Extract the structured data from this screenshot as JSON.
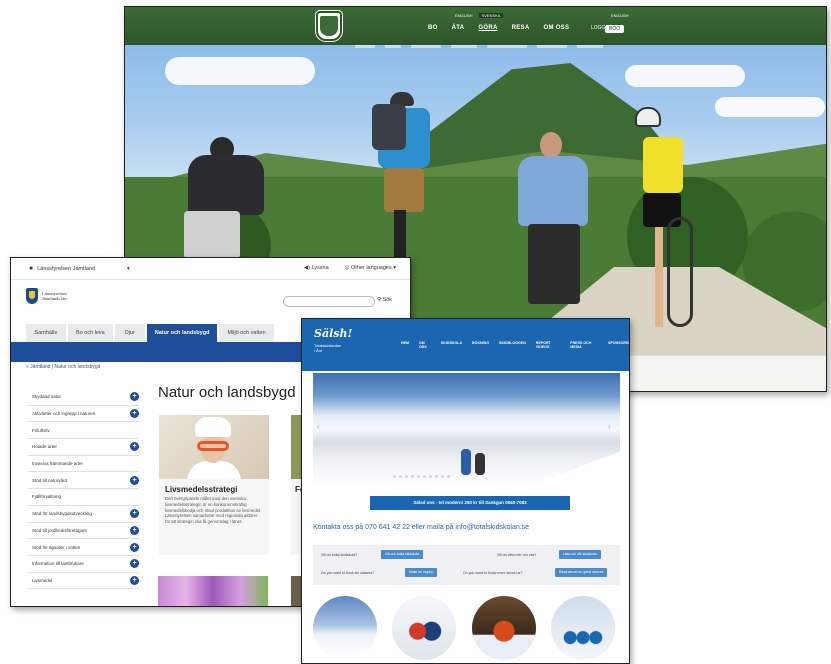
{
  "bike_site": {
    "lang": [
      "ENGLISH",
      "SVENSKA"
    ],
    "lang_small": "ENGLISH",
    "menu": [
      "BO",
      "ÄTA",
      "GÖRA",
      "RESA",
      "OM OSS"
    ],
    "account_label": "LOGGA IN",
    "account_value": "BOO"
  },
  "lansstyrelsen": {
    "location": "Länsstyrelsen Jämtland",
    "listen": "Lyssna",
    "languages": "Other languages",
    "brand_line1": "Länsstyrelsen",
    "brand_line2": "Jämtlands län",
    "search_button": "Sök",
    "tabs": [
      "Samhälle",
      "Bo och leva",
      "Djur",
      "Natur och landsbygd",
      "Miljö och vatten"
    ],
    "breadcrumb_home": "« Jämtland",
    "breadcrumb_current": "Natur och landsbygd",
    "heading": "Natur och landsbygd",
    "sidebar": [
      {
        "label": "Skyddad natur",
        "plus": true
      },
      {
        "label": "Aktiviteter och ingrepp i naturen",
        "plus": true
      },
      {
        "label": "Friluftsliv",
        "plus": false
      },
      {
        "label": "Hotade arter",
        "plus": true
      },
      {
        "label": "Invasiva främmande arter",
        "plus": false
      },
      {
        "label": "Stöd till naturvård",
        "plus": true
      },
      {
        "label": "Fjällförvaltning",
        "plus": false
      },
      {
        "label": "Stöd för landsbygdsutveckling",
        "plus": true
      },
      {
        "label": "Stöd till jordbruksföretagare",
        "plus": true
      },
      {
        "label": "Stöd för ägarder i vatten",
        "plus": true
      },
      {
        "label": "Information till lantbrukare",
        "plus": true
      },
      {
        "label": "Livsmedel",
        "plus": true
      }
    ],
    "card_title": "Livsmedelsstrategi",
    "card_text": "Den övergripande målet med den svenska livsmedelsstrategin är en konkurrenskraftig livsmedelskedja och ökad produktion av livsmedel. Länsstyrelsen samarbetar med regionala aktörer för att strategin ska få genomslag i länet.",
    "card2_title": "Fö",
    "card2_text": "..."
  },
  "ski_school": {
    "logo": "Sälsh!",
    "logo_sub_1": "Totalskidskolan",
    "logo_sub_2": "i Åre",
    "menu": [
      "HEM",
      "OM OSS",
      "SKIDSKOLA",
      "BOKNING",
      "SKIDBLOGGEN",
      "REPORT VIDEOS",
      "PRESS OCH MEDIA",
      "SPONSORER"
    ],
    "ribbon": "Sälsd ons - tel modern! 250 kr till Sankgan 0840-7083",
    "contact": "Kontakta oss på 070 641 42 22 eller maila på info@totalskidskolan.se",
    "questions": [
      {
        "q": "Vill du boka skidskola?",
        "btn": "Gå och boka skidskola"
      },
      {
        "q": "Vill du veta mer om oss?",
        "btn": "Läsa om vår skidskola"
      },
      {
        "q": "Do you want to book ski classes?",
        "btn": "Make an inquiry"
      },
      {
        "q": "Do you want to know more about us?",
        "btn": "Read about our great classes"
      }
    ]
  },
  "colors": {
    "green_nav": "#3d6b37",
    "lans_blue": "#1f4e9a",
    "ski_blue": "#1a66b0"
  }
}
